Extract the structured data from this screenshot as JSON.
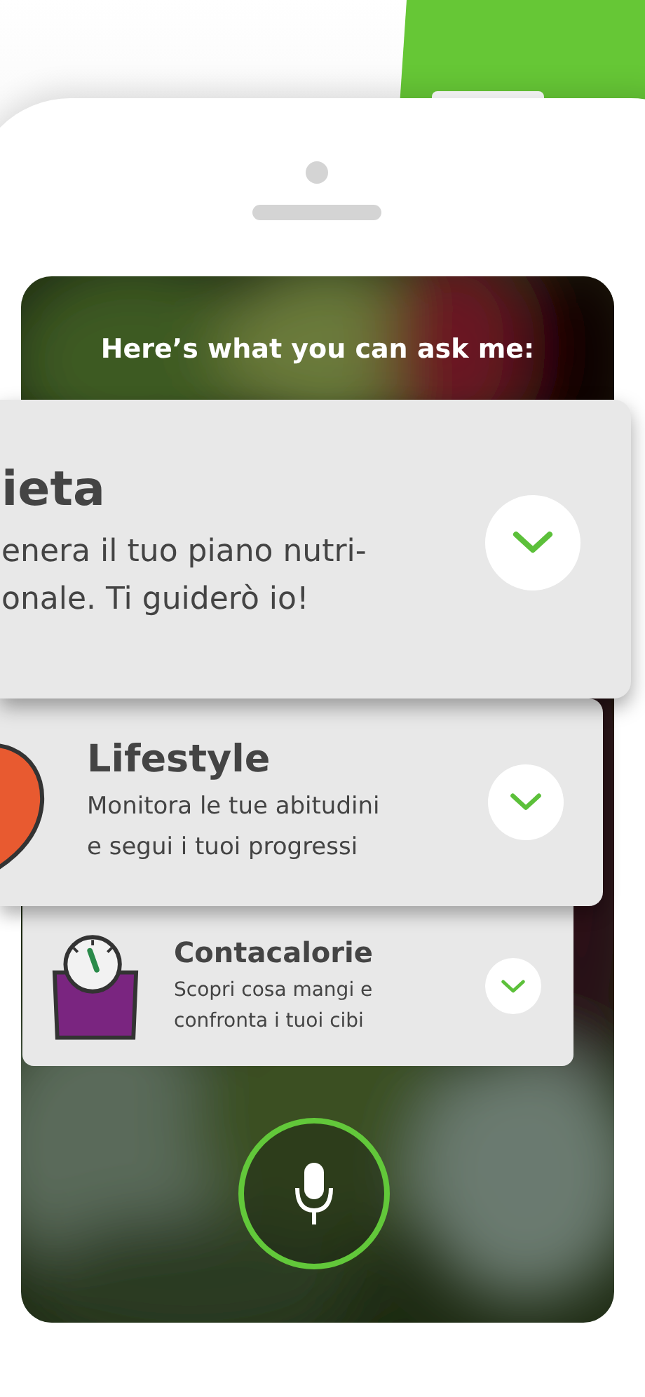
{
  "screen": {
    "prompt": "Here’s what you can ask me:",
    "suggestions": [
      {
        "kind": "large",
        "title": "ieta",
        "description": "enera il tuo piano nutri-\nonale. Ti guiderò io!"
      },
      {
        "kind": "medium",
        "title": "Lifestyle",
        "description": "Monitora le tue abitudini\ne segui i tuoi progressi"
      },
      {
        "kind": "small",
        "title": "Contacalorie",
        "description": "Scopri cosa mangi e\nconfronta i tuoi cibi"
      }
    ]
  }
}
